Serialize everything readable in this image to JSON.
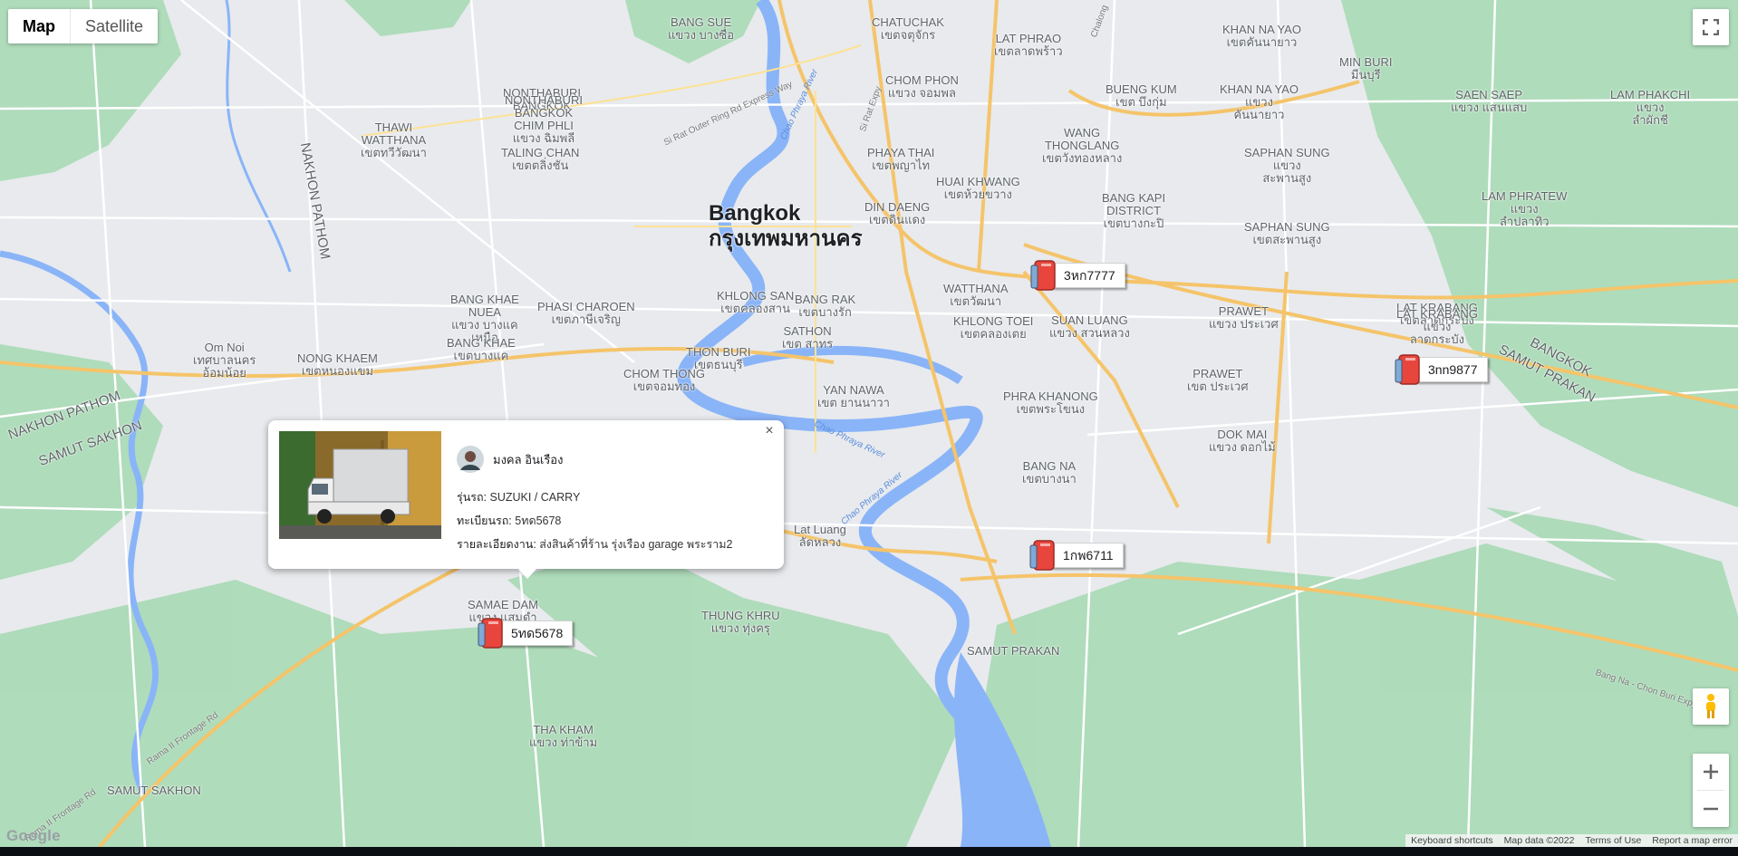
{
  "map_type": {
    "map": "Map",
    "satellite": "Satellite"
  },
  "places": [
    {
      "text": "Bangkok",
      "cls": "city"
    },
    {
      "text": "กรุงเทพมหานคร",
      "cls": "city"
    },
    {
      "text": "BANG SUE\nแขวง บางซื่อ",
      "cls": ""
    },
    {
      "text": "CHATUCHAK\nเขตจตุจักร",
      "cls": ""
    },
    {
      "text": "LAT PHRAO\nเขตลาดพร้าว",
      "cls": ""
    },
    {
      "text": "KHAN NA YAO\nเขตคันนายาว",
      "cls": ""
    },
    {
      "text": "MIN BURI\nมีนบุรี",
      "cls": ""
    },
    {
      "text": "SAEN SAEP\nแขวง แสนแสบ",
      "cls": ""
    },
    {
      "text": "LAM PHAKCHI\nแขวง\nลำผักชี",
      "cls": ""
    },
    {
      "text": "NONTHABURI\nBANGKOK",
      "cls": ""
    },
    {
      "text": "NONTHABURI\nBANGKOK\nCHIM PHLI\nแขวง ฉิมพลี",
      "cls": ""
    },
    {
      "text": "TALING CHAN\nเขตตลิ่งชัน",
      "cls": ""
    },
    {
      "text": "THAWI\nWATTHANA\nเขตทวีวัฒนา",
      "cls": ""
    },
    {
      "text": "CHOM PHON\nแขวง จอมพล",
      "cls": ""
    },
    {
      "text": "BUENG KUM\nเขต บึงกุ่ม",
      "cls": ""
    },
    {
      "text": "KHAN NA YAO\nแขวง\nคันนายาว",
      "cls": ""
    },
    {
      "text": "PHAYA THAI\nเขตพญาไท",
      "cls": ""
    },
    {
      "text": "WANG\nTHONGLANG\nเขตวังทองหลาง",
      "cls": ""
    },
    {
      "text": "HUAI KHWANG\nเขตห้วยขวาง",
      "cls": ""
    },
    {
      "text": "SAPHAN SUNG\nแขวง\nสะพานสูง",
      "cls": ""
    },
    {
      "text": "LAM PHRATEW\nแขวง\nลำปลาทิว",
      "cls": ""
    },
    {
      "text": "DIN DAENG\nเขตดินแดง",
      "cls": ""
    },
    {
      "text": "BANG KAPI\nDISTRICT\nเขตบางกะปิ",
      "cls": ""
    },
    {
      "text": "SAPHAN SUNG\nเขตสะพานสูง",
      "cls": ""
    },
    {
      "text": "LAT KRABANG\nเขตลาดกระบัง",
      "cls": ""
    },
    {
      "text": "BANG KHAE\nNUEA\nแขวง บางแค\nเหนือ",
      "cls": ""
    },
    {
      "text": "PHASI CHAROEN\nเขตภาษีเจริญ",
      "cls": ""
    },
    {
      "text": "KHLONG SAN\nเขตคลองสาน",
      "cls": ""
    },
    {
      "text": "BANG RAK\nเขตบางรัก",
      "cls": ""
    },
    {
      "text": "WATTHANA\nเขตวัฒนา",
      "cls": ""
    },
    {
      "text": "SUAN LUANG\nแขวง สวนหลวง",
      "cls": ""
    },
    {
      "text": "PRAWET\nแขวง ประเวศ",
      "cls": ""
    },
    {
      "text": "LAT KRABANG\nแขวง\nลาดกระบัง",
      "cls": ""
    },
    {
      "text": "Om Noi\nเทศบาลนคร\nอ้อมน้อย",
      "cls": ""
    },
    {
      "text": "NONG KHAEM\nเขตหนองแขม",
      "cls": ""
    },
    {
      "text": "BANG KHAE\nเขตบางแค",
      "cls": ""
    },
    {
      "text": "THON BURI\nเขตธนบุรี",
      "cls": ""
    },
    {
      "text": "SATHON\nเขต สาทร",
      "cls": ""
    },
    {
      "text": "KHLONG TOEI\nเขตคลองเตย",
      "cls": ""
    },
    {
      "text": "CHOM THONG\nเขตจอมทอง",
      "cls": ""
    },
    {
      "text": "YAN NAWA\nเขต ยานนาวา",
      "cls": ""
    },
    {
      "text": "PHRA KHANONG\nเขตพระโขนง",
      "cls": ""
    },
    {
      "text": "PRAWET\nเขต ประเวศ",
      "cls": ""
    },
    {
      "text": "DOK MAI\nแขวง ดอกไม้",
      "cls": ""
    },
    {
      "text": "NAKHON PATHOM",
      "cls": ""
    },
    {
      "text": "SAMUT SAKHON",
      "cls": ""
    },
    {
      "text": "BANG NA\nเขตบางนา",
      "cls": ""
    },
    {
      "text": "Lat Luang\nลัดหลวง",
      "cls": ""
    },
    {
      "text": "SAMAE DAM\nแขวง แสมดำ",
      "cls": ""
    },
    {
      "text": "THUNG KHRU\nแขวง ทุ่งครุ",
      "cls": ""
    },
    {
      "text": "SAMUT PRAKAN",
      "cls": ""
    },
    {
      "text": "THA KHAM\nแขวง ท่าข้าม",
      "cls": ""
    },
    {
      "text": "SAMUT SAKHON",
      "cls": ""
    },
    {
      "text": "BANGKOK",
      "cls": ""
    },
    {
      "text": "SAMUT PRAKAN",
      "cls": ""
    },
    {
      "text": "NAKHON PATHOM",
      "cls": ""
    },
    {
      "text": "BANGKOK",
      "cls": ""
    }
  ],
  "roads": [
    "Si Rat Outer Ring Rd Express Way",
    "Rama II Frontage Rd",
    "Rama II Frontage Rd",
    "Bang Na - Chon Buri Expy",
    "Si Rat Expy",
    "Chalong"
  ],
  "rivers": [
    "Chao Phraya River",
    "Chao Phraya River",
    "Chao Phraya River"
  ],
  "markers": [
    {
      "plate": "3หก7777"
    },
    {
      "plate": "3nn9877"
    },
    {
      "plate": "1กพ6711"
    },
    {
      "plate": "5ทด5678"
    }
  ],
  "info_window": {
    "driver_name": "มงคล อินเรือง",
    "model_label": "รุ่นรถ: ",
    "model_value": "SUZUKI / CARRY",
    "plate_label": "ทะเบียนรถ: ",
    "plate_value": "5ทด5678",
    "detail_label": "รายละเอียดงาน: ",
    "detail_value": "ส่งสินค้าที่ร้าน รุ่งเรือง garage พระราม2",
    "close": "×"
  },
  "footer": {
    "logo": "Google",
    "shortcuts": "Keyboard shortcuts",
    "map_data": "Map data ©2022",
    "terms": "Terms of Use",
    "report": "Report a map error"
  },
  "colors": {
    "land": "#e8eaed",
    "park": "#a8dab5",
    "water": "#8ab4f8",
    "highway": "#f5c46a",
    "marker": "#e8453c"
  }
}
